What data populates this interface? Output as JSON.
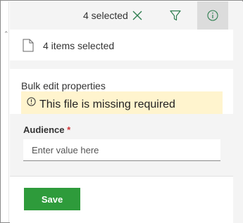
{
  "header": {
    "selected_count_text": "4 selected",
    "clear_icon": "close-icon",
    "filter_icon": "filter-icon",
    "info_icon": "info-icon"
  },
  "items_summary": {
    "icon": "document-icon",
    "text": "4 items selected"
  },
  "bulk_edit": {
    "title": "Bulk edit properties",
    "warning": {
      "icon": "warning-circle-icon",
      "text": "This file is missing required"
    },
    "audience_field": {
      "label": "Audience",
      "required_mark": "*",
      "value": "",
      "placeholder": "Enter value here"
    },
    "save_label": "Save"
  },
  "colors": {
    "save_button": "#2e9b3b",
    "warning_bg": "#fff4ce",
    "required_star": "#d13438",
    "panel_bg": "#f4f4f4"
  }
}
